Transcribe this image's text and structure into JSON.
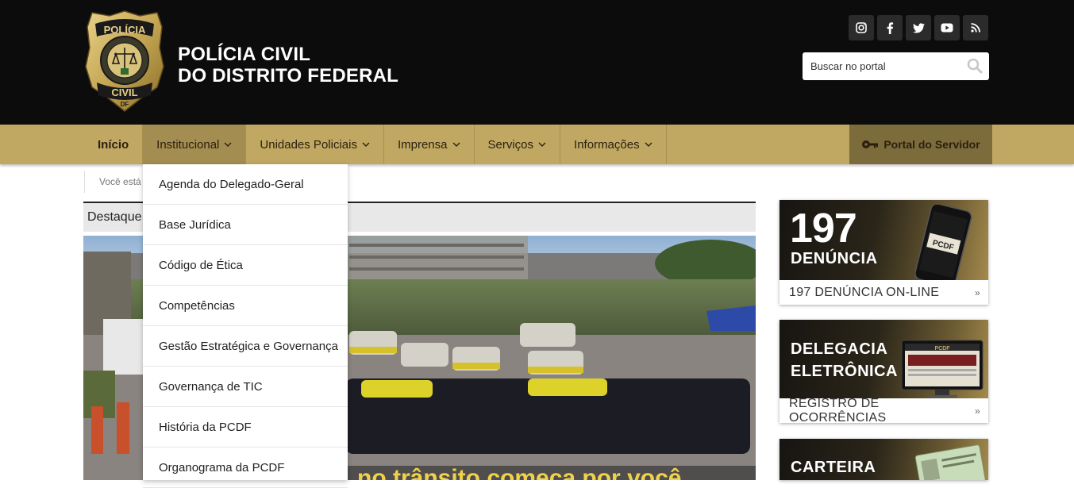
{
  "header": {
    "title_line1": "POLÍCIA CIVIL",
    "title_line2": "DO DISTRITO FEDERAL",
    "logo": {
      "top_text": "POLÍCIA",
      "bottom_text": "CIVIL",
      "region": "DF"
    },
    "social_icons": [
      "instagram-icon",
      "facebook-icon",
      "twitter-icon",
      "youtube-icon",
      "rss-icon"
    ],
    "search": {
      "placeholder": "Buscar no portal"
    }
  },
  "nav": {
    "items": [
      {
        "label": "Início"
      },
      {
        "label": "Institucional",
        "chevron": "⌄"
      },
      {
        "label": "Unidades Policiais",
        "chevron": "⌄"
      },
      {
        "label": "Imprensa",
        "chevron": "⌄"
      },
      {
        "label": "Serviços",
        "chevron": "⌄"
      },
      {
        "label": "Informações",
        "chevron": "⌄"
      }
    ],
    "portal_label": "Portal do Servidor"
  },
  "breadcrumb": {
    "text": "Você está"
  },
  "destaque": {
    "label": "Destaque"
  },
  "hero": {
    "overlay_text": "no trânsito começa por você"
  },
  "dropdown": {
    "items": [
      "Agenda do Delegado-Geral",
      "Base Jurídica",
      "Código de Ética",
      "Competências",
      "Gestão Estratégica e Governança",
      "Governança de TIC",
      "História da PCDF",
      "Organograma da PCDF"
    ]
  },
  "cards": {
    "denuncia": {
      "number": "197",
      "title": "DENÚNCIA",
      "caption": "197 DENÚNCIA ON-LINE",
      "phone_text": "PCDF",
      "arrow": "»"
    },
    "delegacia": {
      "title_line1": "DELEGACIA",
      "title_line2": "ELETRÔNICA",
      "caption": "REGISTRO DE OCORRÊNCIAS",
      "screen_text": "PCDF",
      "arrow": "»"
    },
    "carteira": {
      "title": "CARTEIRA"
    }
  },
  "colors": {
    "header_bg": "#0c0c0c",
    "nav_gold": "#c0a862",
    "nav_active": "#a48d50",
    "portal_bg": "#7d6c3b"
  }
}
